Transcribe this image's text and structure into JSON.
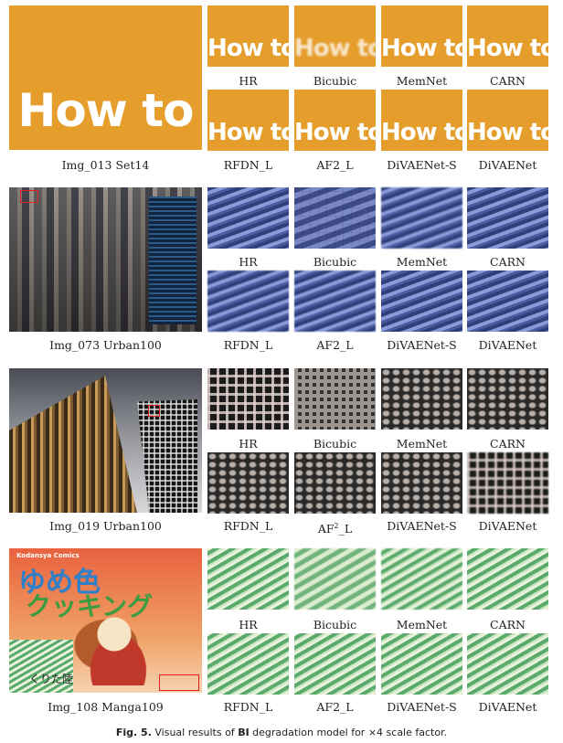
{
  "figure": {
    "caption_label": "Fig. 5.",
    "caption_pre": "Visual results of",
    "caption_bold": "BI",
    "caption_post": "degradation model for ×4 scale factor."
  },
  "rows": [
    {
      "main_label": "Img_013 Set14",
      "patch_text": "How to",
      "labels_top": [
        "HR",
        "Bicubic",
        "MemNet",
        "CARN"
      ],
      "labels_bottom": [
        "RFDN_L",
        "AF2_L",
        "DiVAENet-S",
        "DiVAENet"
      ]
    },
    {
      "main_label": "Img_073 Urban100",
      "labels_top": [
        "HR",
        "Bicubic",
        "MemNet",
        "CARN"
      ],
      "labels_bottom": [
        "RFDN_L",
        "AF2_L",
        "DiVAENet-S",
        "DiVAENet"
      ]
    },
    {
      "main_label": "Img_019 Urban100",
      "labels_top": [
        "HR",
        "Bicubic",
        "MemNet",
        "CARN"
      ],
      "labels_bottom": [
        "RFDN_L",
        "AF",
        "DiVAENet-S",
        "DiVAENet"
      ],
      "af_sup": "2",
      "af_tail": "_L"
    },
    {
      "main_label": "Img_108 Manga109",
      "labels_top": [
        "HR",
        "Bicubic",
        "MemNet",
        "CARN"
      ],
      "labels_bottom": [
        "RFDN_L",
        "AF2_L",
        "DiVAENet-S",
        "DiVAENet"
      ],
      "cover_logo": "Kodansya Comics",
      "cover_title1": "ゆめ色",
      "cover_title2": "クッキング",
      "cover_author": "くりた陸"
    }
  ]
}
